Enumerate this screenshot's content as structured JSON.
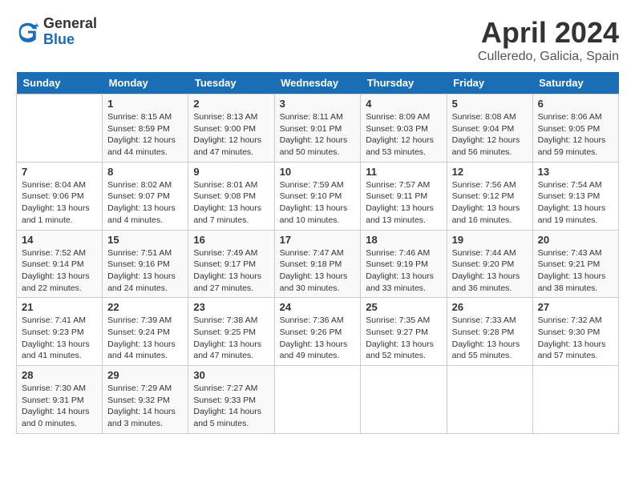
{
  "logo": {
    "general": "General",
    "blue": "Blue"
  },
  "title": "April 2024",
  "location": "Culleredo, Galicia, Spain",
  "headers": [
    "Sunday",
    "Monday",
    "Tuesday",
    "Wednesday",
    "Thursday",
    "Friday",
    "Saturday"
  ],
  "weeks": [
    [
      {
        "day": "",
        "sunrise": "",
        "sunset": "",
        "daylight": ""
      },
      {
        "day": "1",
        "sunrise": "Sunrise: 8:15 AM",
        "sunset": "Sunset: 8:59 PM",
        "daylight": "Daylight: 12 hours and 44 minutes."
      },
      {
        "day": "2",
        "sunrise": "Sunrise: 8:13 AM",
        "sunset": "Sunset: 9:00 PM",
        "daylight": "Daylight: 12 hours and 47 minutes."
      },
      {
        "day": "3",
        "sunrise": "Sunrise: 8:11 AM",
        "sunset": "Sunset: 9:01 PM",
        "daylight": "Daylight: 12 hours and 50 minutes."
      },
      {
        "day": "4",
        "sunrise": "Sunrise: 8:09 AM",
        "sunset": "Sunset: 9:03 PM",
        "daylight": "Daylight: 12 hours and 53 minutes."
      },
      {
        "day": "5",
        "sunrise": "Sunrise: 8:08 AM",
        "sunset": "Sunset: 9:04 PM",
        "daylight": "Daylight: 12 hours and 56 minutes."
      },
      {
        "day": "6",
        "sunrise": "Sunrise: 8:06 AM",
        "sunset": "Sunset: 9:05 PM",
        "daylight": "Daylight: 12 hours and 59 minutes."
      }
    ],
    [
      {
        "day": "7",
        "sunrise": "Sunrise: 8:04 AM",
        "sunset": "Sunset: 9:06 PM",
        "daylight": "Daylight: 13 hours and 1 minute."
      },
      {
        "day": "8",
        "sunrise": "Sunrise: 8:02 AM",
        "sunset": "Sunset: 9:07 PM",
        "daylight": "Daylight: 13 hours and 4 minutes."
      },
      {
        "day": "9",
        "sunrise": "Sunrise: 8:01 AM",
        "sunset": "Sunset: 9:08 PM",
        "daylight": "Daylight: 13 hours and 7 minutes."
      },
      {
        "day": "10",
        "sunrise": "Sunrise: 7:59 AM",
        "sunset": "Sunset: 9:10 PM",
        "daylight": "Daylight: 13 hours and 10 minutes."
      },
      {
        "day": "11",
        "sunrise": "Sunrise: 7:57 AM",
        "sunset": "Sunset: 9:11 PM",
        "daylight": "Daylight: 13 hours and 13 minutes."
      },
      {
        "day": "12",
        "sunrise": "Sunrise: 7:56 AM",
        "sunset": "Sunset: 9:12 PM",
        "daylight": "Daylight: 13 hours and 16 minutes."
      },
      {
        "day": "13",
        "sunrise": "Sunrise: 7:54 AM",
        "sunset": "Sunset: 9:13 PM",
        "daylight": "Daylight: 13 hours and 19 minutes."
      }
    ],
    [
      {
        "day": "14",
        "sunrise": "Sunrise: 7:52 AM",
        "sunset": "Sunset: 9:14 PM",
        "daylight": "Daylight: 13 hours and 22 minutes."
      },
      {
        "day": "15",
        "sunrise": "Sunrise: 7:51 AM",
        "sunset": "Sunset: 9:16 PM",
        "daylight": "Daylight: 13 hours and 24 minutes."
      },
      {
        "day": "16",
        "sunrise": "Sunrise: 7:49 AM",
        "sunset": "Sunset: 9:17 PM",
        "daylight": "Daylight: 13 hours and 27 minutes."
      },
      {
        "day": "17",
        "sunrise": "Sunrise: 7:47 AM",
        "sunset": "Sunset: 9:18 PM",
        "daylight": "Daylight: 13 hours and 30 minutes."
      },
      {
        "day": "18",
        "sunrise": "Sunrise: 7:46 AM",
        "sunset": "Sunset: 9:19 PM",
        "daylight": "Daylight: 13 hours and 33 minutes."
      },
      {
        "day": "19",
        "sunrise": "Sunrise: 7:44 AM",
        "sunset": "Sunset: 9:20 PM",
        "daylight": "Daylight: 13 hours and 36 minutes."
      },
      {
        "day": "20",
        "sunrise": "Sunrise: 7:43 AM",
        "sunset": "Sunset: 9:21 PM",
        "daylight": "Daylight: 13 hours and 38 minutes."
      }
    ],
    [
      {
        "day": "21",
        "sunrise": "Sunrise: 7:41 AM",
        "sunset": "Sunset: 9:23 PM",
        "daylight": "Daylight: 13 hours and 41 minutes."
      },
      {
        "day": "22",
        "sunrise": "Sunrise: 7:39 AM",
        "sunset": "Sunset: 9:24 PM",
        "daylight": "Daylight: 13 hours and 44 minutes."
      },
      {
        "day": "23",
        "sunrise": "Sunrise: 7:38 AM",
        "sunset": "Sunset: 9:25 PM",
        "daylight": "Daylight: 13 hours and 47 minutes."
      },
      {
        "day": "24",
        "sunrise": "Sunrise: 7:36 AM",
        "sunset": "Sunset: 9:26 PM",
        "daylight": "Daylight: 13 hours and 49 minutes."
      },
      {
        "day": "25",
        "sunrise": "Sunrise: 7:35 AM",
        "sunset": "Sunset: 9:27 PM",
        "daylight": "Daylight: 13 hours and 52 minutes."
      },
      {
        "day": "26",
        "sunrise": "Sunrise: 7:33 AM",
        "sunset": "Sunset: 9:28 PM",
        "daylight": "Daylight: 13 hours and 55 minutes."
      },
      {
        "day": "27",
        "sunrise": "Sunrise: 7:32 AM",
        "sunset": "Sunset: 9:30 PM",
        "daylight": "Daylight: 13 hours and 57 minutes."
      }
    ],
    [
      {
        "day": "28",
        "sunrise": "Sunrise: 7:30 AM",
        "sunset": "Sunset: 9:31 PM",
        "daylight": "Daylight: 14 hours and 0 minutes."
      },
      {
        "day": "29",
        "sunrise": "Sunrise: 7:29 AM",
        "sunset": "Sunset: 9:32 PM",
        "daylight": "Daylight: 14 hours and 3 minutes."
      },
      {
        "day": "30",
        "sunrise": "Sunrise: 7:27 AM",
        "sunset": "Sunset: 9:33 PM",
        "daylight": "Daylight: 14 hours and 5 minutes."
      },
      {
        "day": "",
        "sunrise": "",
        "sunset": "",
        "daylight": ""
      },
      {
        "day": "",
        "sunrise": "",
        "sunset": "",
        "daylight": ""
      },
      {
        "day": "",
        "sunrise": "",
        "sunset": "",
        "daylight": ""
      },
      {
        "day": "",
        "sunrise": "",
        "sunset": "",
        "daylight": ""
      }
    ]
  ]
}
